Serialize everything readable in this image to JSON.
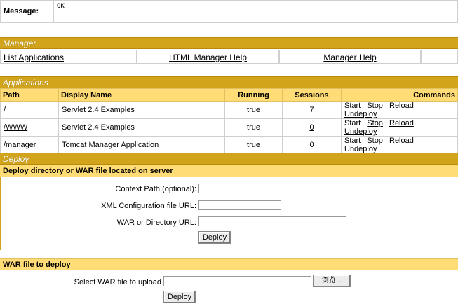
{
  "message": {
    "label": "Message:",
    "text": "OK"
  },
  "manager": {
    "title": "Manager",
    "links": [
      "List Applications",
      "HTML Manager Help",
      "Manager Help"
    ]
  },
  "applications": {
    "title": "Applications",
    "columns": [
      "Path",
      "Display Name",
      "Running",
      "Sessions",
      "Commands"
    ],
    "rows": [
      {
        "path": "/",
        "name": "Servlet 2.4 Examples",
        "running": "true",
        "sessions": "7"
      },
      {
        "path": "/WWW",
        "name": "Servlet 2.4 Examples",
        "running": "true",
        "sessions": "0"
      },
      {
        "path": "/manager",
        "name": "Tomcat Manager Application",
        "running": "true",
        "sessions": "0"
      }
    ],
    "commands": [
      "Start",
      "Stop",
      "Reload",
      "Undeploy"
    ]
  },
  "deploy": {
    "title": "Deploy",
    "server_subtitle": "Deploy directory or WAR file located on server",
    "context_path_label": "Context Path (optional):",
    "xml_config_label": "XML Configuration file URL:",
    "war_dir_label": "WAR or Directory URL:",
    "deploy_button": "Deploy",
    "war_subtitle": "WAR file to deploy",
    "select_war_label": "Select WAR file to upload",
    "browse_button": "浏览...",
    "upload_deploy_button": "Deploy"
  }
}
